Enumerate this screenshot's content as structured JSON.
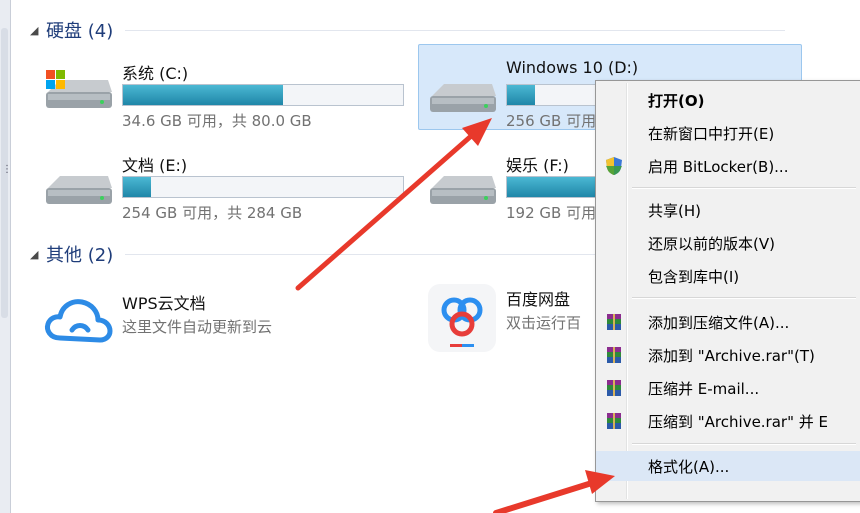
{
  "sections": {
    "hard_disks": "硬盘 (4)",
    "other": "其他 (2)"
  },
  "drives": [
    {
      "name": "系统 (C:)",
      "free": "34.6 GB 可用，共 80.0 GB",
      "used_fraction": 0.57
    },
    {
      "name": "Windows 10 (D:)",
      "free": "256 GB 可用",
      "used_fraction": 0.1
    },
    {
      "name": "文档 (E:)",
      "free": "254 GB 可用，共 284 GB",
      "used_fraction": 0.1
    },
    {
      "name": "娱乐 (F:)",
      "free": "192 GB 可用",
      "used_fraction": 0.32
    }
  ],
  "others": [
    {
      "name": "WPS云文档",
      "desc": "这里文件自动更新到云",
      "icon": "wps-cloud-icon"
    },
    {
      "name": "百度网盘",
      "desc": "双击运行百",
      "icon": "baidu-netdisk-icon"
    }
  ],
  "menu": {
    "open": "打开(O)",
    "open_new_window": "在新窗口中打开(E)",
    "bitlocker": "启用 BitLocker(B)...",
    "share": "共享(H)",
    "restore": "还原以前的版本(V)",
    "include_library": "包含到库中(I)",
    "add_archive": "添加到压缩文件(A)...",
    "add_archive_rar": "添加到 \"Archive.rar\"(T)",
    "compress_email": "压缩并 E-mail...",
    "compress_rar_email": "压缩到 \"Archive.rar\" 并 E",
    "format": "格式化(A)..."
  },
  "colors": {
    "accent_arrow": "#e8392b",
    "drive_bar": "#2a95b8",
    "selection": "#d7e8fa"
  }
}
